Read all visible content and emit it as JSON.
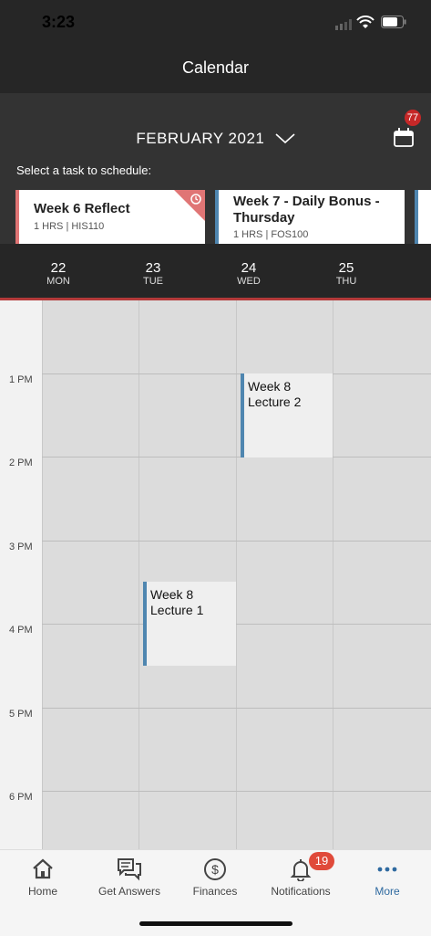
{
  "status_bar": {
    "time": "3:23"
  },
  "nav": {
    "title": "Calendar"
  },
  "header": {
    "month": "FEBRUARY 2021",
    "calendar_badge": "77",
    "select_label": "Select a task to schedule:"
  },
  "tasks": [
    {
      "title": "Week 6 Reflect",
      "meta": "1 HRS | HIS110",
      "color": "#e07575"
    },
    {
      "title": "Week 7 - Daily Bonus - Thursday",
      "meta": "1 HRS | FOS100",
      "color": "#4f86b0"
    }
  ],
  "days": [
    {
      "num": "22",
      "name": "MON"
    },
    {
      "num": "23",
      "name": "TUE"
    },
    {
      "num": "24",
      "name": "WED"
    },
    {
      "num": "25",
      "name": "THU"
    }
  ],
  "hours": [
    "1 PM",
    "2 PM",
    "3 PM",
    "4 PM",
    "5 PM",
    "6 PM"
  ],
  "events": [
    {
      "title": "Week 8 Lecture 2",
      "day": "WED",
      "start": "1 PM",
      "end": "2 PM"
    },
    {
      "title": "Week 8 Lecture 1",
      "day": "TUE",
      "start": "3:30 PM",
      "end": "4:30 PM"
    }
  ],
  "tabbar": {
    "items": [
      {
        "label": "Home",
        "icon": "home-icon"
      },
      {
        "label": "Get Answers",
        "icon": "chat-icon"
      },
      {
        "label": "Finances",
        "icon": "dollar-icon"
      },
      {
        "label": "Notifications",
        "icon": "bell-icon"
      },
      {
        "label": "More",
        "icon": "more-icon"
      }
    ],
    "notifications_badge": "19",
    "active": "More"
  },
  "colors": {
    "accent": "#2f6aa0",
    "event": "#4f86b0",
    "badge": "#c62828"
  }
}
